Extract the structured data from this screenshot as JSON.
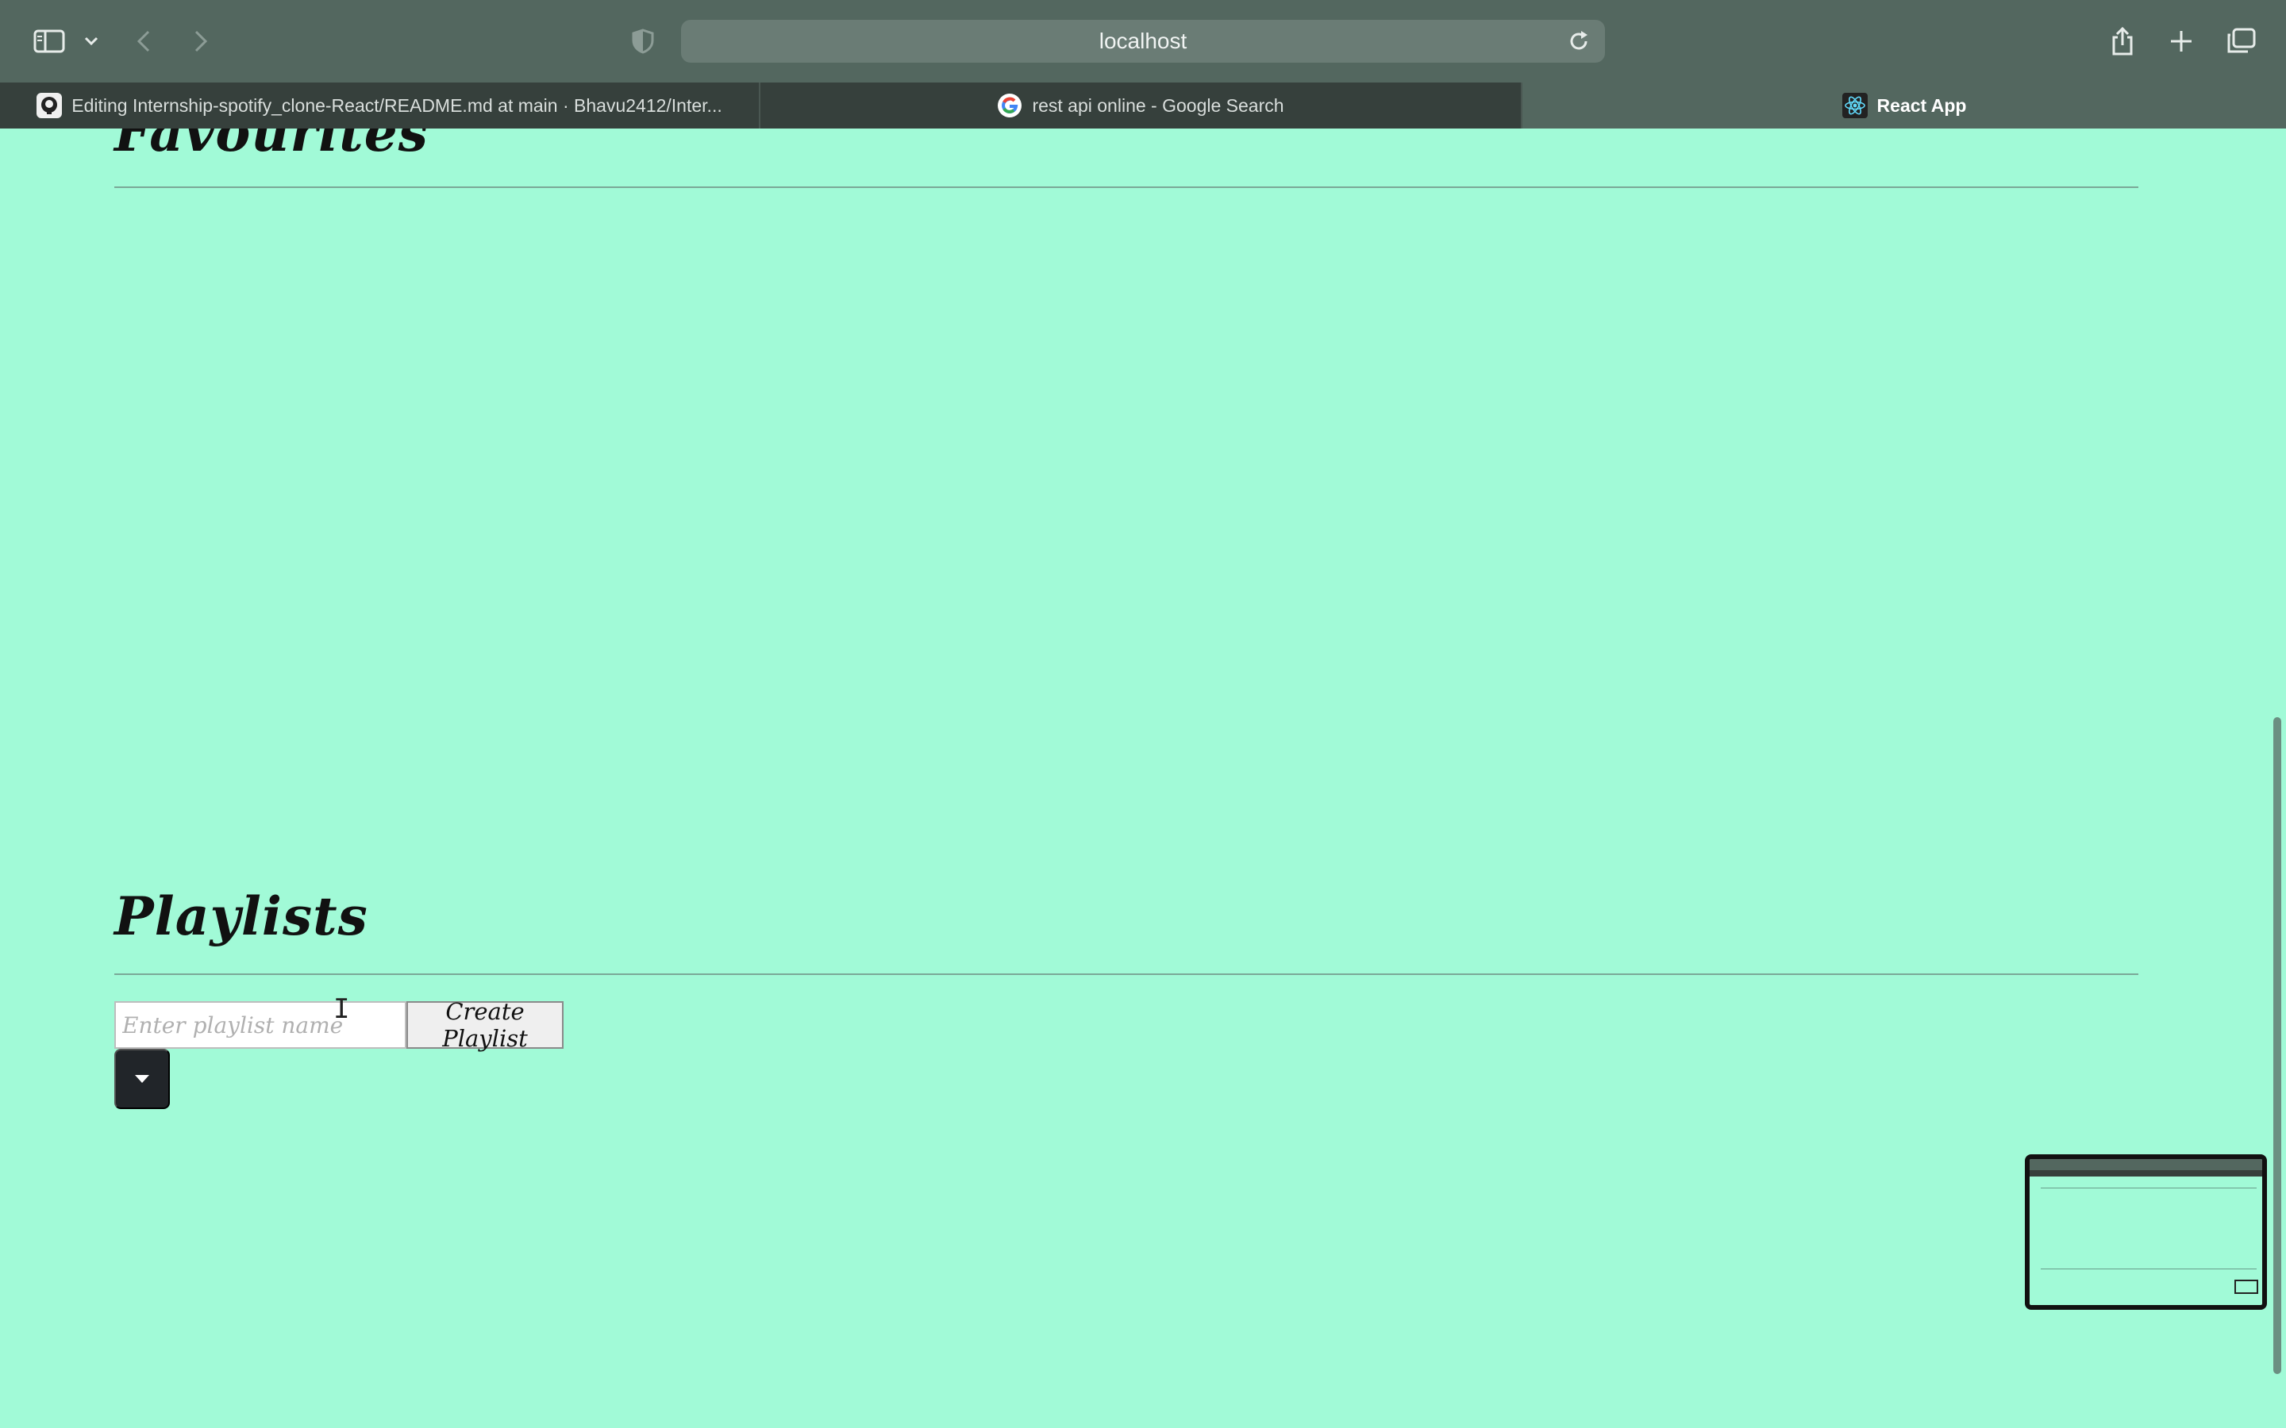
{
  "browser": {
    "url": "localhost",
    "tabs": [
      {
        "title": "Editing Internship-spotify_clone-React/README.md at main · Bhavu2412/Inter...",
        "icon": "github-icon",
        "active": false
      },
      {
        "title": "rest api online - Google Search",
        "icon": "google-icon",
        "active": false
      },
      {
        "title": "React App",
        "icon": "react-icon",
        "active": true
      }
    ]
  },
  "page": {
    "favourites_heading": "Favourites",
    "playlists_heading": "Playlists",
    "playlist_input": {
      "value": "",
      "placeholder": "Enter playlist name"
    },
    "create_button": "Create Playlist",
    "dropdown_icon": "caret-down-icon"
  },
  "colors": {
    "page_background": "#a1fad7",
    "toolbar": "#53675f",
    "tabbar": "#36403c",
    "dropdown_button": "#212529"
  }
}
